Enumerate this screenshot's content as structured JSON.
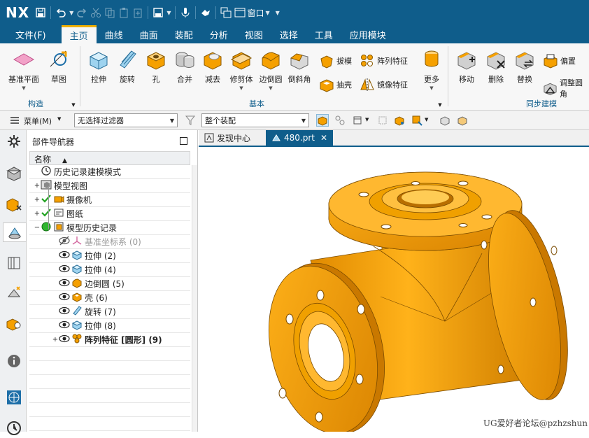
{
  "app": {
    "logo": "NX",
    "window_menu": "窗口"
  },
  "quick_access": [
    "save-icon",
    "undo-icon",
    "redo-icon",
    "cut-icon",
    "copy-icon",
    "paste-icon",
    "paste-special-icon",
    "save-options-icon",
    "microphone-icon",
    "touch-mode-icon",
    "switch-window-icon",
    "window-icon"
  ],
  "menu": {
    "file": "文件(F)",
    "tabs": [
      "主页",
      "曲线",
      "曲面",
      "装配",
      "分析",
      "视图",
      "选择",
      "工具",
      "应用模块"
    ],
    "active_tab": "主页"
  },
  "ribbon": {
    "construct": {
      "label": "构造",
      "datum_plane": "基准平面",
      "sketch": "草图"
    },
    "basic": {
      "label": "基本",
      "extrude": "拉伸",
      "revolve": "旋转",
      "hole": "孔",
      "unite": "合并",
      "subtract": "减去",
      "trim_body": "修剪体",
      "edge_blend": "边倒圆",
      "chamfer": "倒斜角",
      "draft": "拔模",
      "shell": "抽壳",
      "pattern_feature": "阵列特征",
      "mirror_feature": "镜像特征",
      "more": "更多"
    },
    "sync": {
      "label": "同步建模",
      "move": "移动",
      "delete": "删除",
      "replace": "替换",
      "offset": "偏置",
      "resize_blend": "调整圆角"
    }
  },
  "filterbar": {
    "menu": "菜单(M)",
    "type_filter": "无选择过滤器",
    "scope_filter": "整个装配"
  },
  "navigator": {
    "title": "部件导航器",
    "column_name": "名称",
    "items": [
      {
        "label": "历史记录建模模式",
        "icon": "clock-icon",
        "expand": ""
      },
      {
        "label": "模型视图",
        "icon": "model-views-icon",
        "expand": "+"
      },
      {
        "label": "摄像机",
        "icon": "camera-icon",
        "expand": "+",
        "check": true
      },
      {
        "label": "图纸",
        "icon": "drawing-icon",
        "expand": "+",
        "check": true
      },
      {
        "label": "模型历史记录",
        "icon": "model-history-icon",
        "expand": "−",
        "status": "green"
      },
      {
        "label": "基准坐标系 (0)",
        "icon": "datum-csys-icon",
        "gray": true
      },
      {
        "label": "拉伸 (2)",
        "icon": "extrude-feature-icon"
      },
      {
        "label": "拉伸 (4)",
        "icon": "extrude-feature-icon"
      },
      {
        "label": "边倒圆 (5)",
        "icon": "blend-feature-icon"
      },
      {
        "label": "壳 (6)",
        "icon": "shell-feature-icon"
      },
      {
        "label": "旋转 (7)",
        "icon": "revolve-feature-icon"
      },
      {
        "label": "拉伸 (8)",
        "icon": "extrude-feature-icon"
      },
      {
        "label": "阵列特征 [圆形] (9)",
        "icon": "pattern-feature-icon",
        "expand": "+",
        "bold": true
      }
    ]
  },
  "tabs": [
    {
      "label": "发现中心",
      "icon": "discovery-icon"
    },
    {
      "label": "480.prt",
      "icon": "part-icon",
      "active": true
    }
  ],
  "viewport": {
    "model": "flanged-tee-pipe",
    "model_color": "#f5a000"
  },
  "watermark": "UG爱好者论坛@pzhzshun",
  "colors": {
    "title_bar": "#0f5d8b",
    "accent_tab": "#f0b000",
    "ribbon_group_label": "#0f5d8b",
    "model_orange": "#f5a000"
  }
}
